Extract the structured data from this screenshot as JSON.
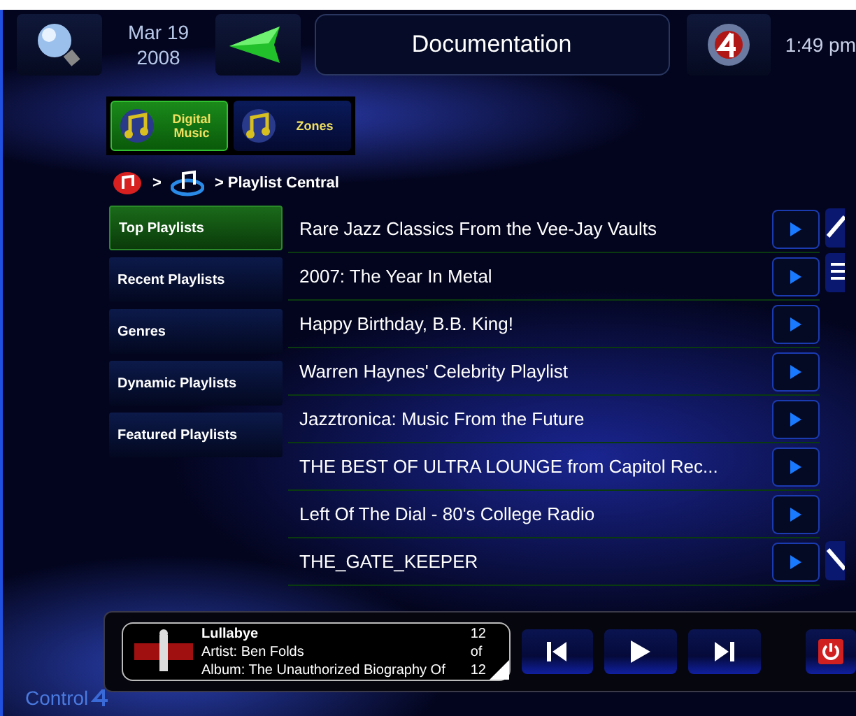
{
  "header": {
    "date": "Mar 19",
    "year": "2008",
    "title": "Documentation",
    "time": "1:49 pm"
  },
  "sources": [
    {
      "label": "Digital Music",
      "selected": true
    },
    {
      "label": "Zones",
      "selected": false
    }
  ],
  "breadcrumb": {
    "separator": ">",
    "current": "> Playlist Central"
  },
  "sidebar": [
    {
      "label": "Top Playlists",
      "selected": true
    },
    {
      "label": "Recent Playlists",
      "selected": false
    },
    {
      "label": "Genres",
      "selected": false
    },
    {
      "label": "Dynamic Playlists",
      "selected": false
    },
    {
      "label": "Featured Playlists",
      "selected": false
    }
  ],
  "playlists": [
    "Rare Jazz Classics From the Vee-Jay Vaults",
    "2007: The Year In Metal",
    "Happy Birthday, B.B. King!",
    "Warren Haynes' Celebrity Playlist",
    "Jazztronica: Music From the Future",
    "THE BEST OF ULTRA LOUNGE from Capitol Rec...",
    "Left Of The Dial - 80's College Radio",
    "THE_GATE_KEEPER"
  ],
  "now_playing": {
    "title": "Lullabye",
    "artist": "Artist: Ben Folds",
    "album": "Album: The Unauthorized Biography Of",
    "track": "12",
    "of": "of",
    "total": "12"
  },
  "footer": {
    "logo": "Control"
  }
}
